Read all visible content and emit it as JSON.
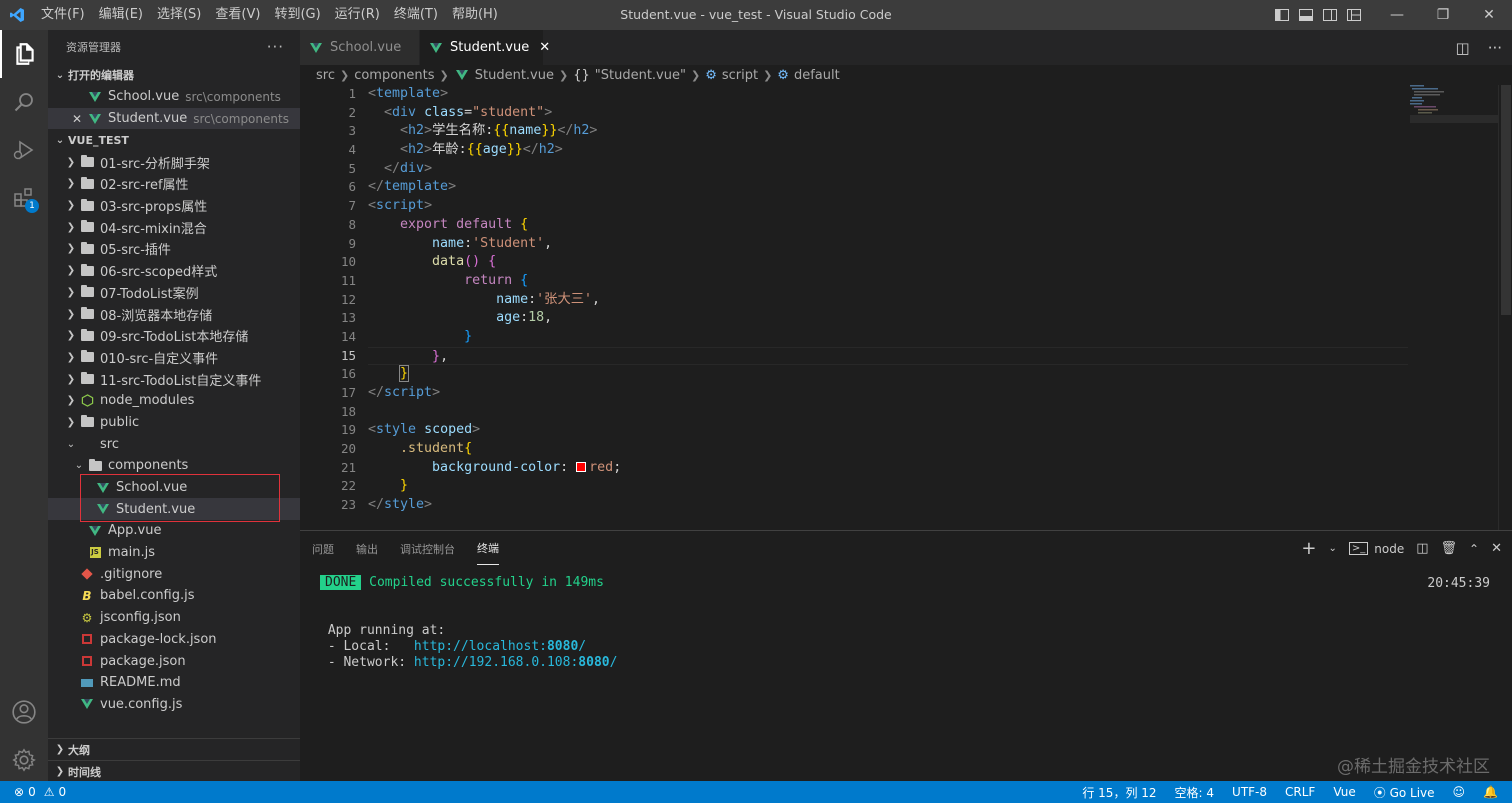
{
  "titlebar": {
    "menu": [
      "文件(F)",
      "编辑(E)",
      "选择(S)",
      "查看(V)",
      "转到(G)",
      "运行(R)",
      "终端(T)",
      "帮助(H)"
    ],
    "title": "Student.vue - vue_test - Visual Studio Code"
  },
  "activity": {
    "extensions_badge": "1"
  },
  "sidebar": {
    "title": "资源管理器",
    "open_editors_header": "打开的编辑器",
    "open_editors": [
      {
        "name": "School.vue",
        "path": "src\\components"
      },
      {
        "name": "Student.vue",
        "path": "src\\components"
      }
    ],
    "project_header": "VUE_TEST",
    "tree": [
      {
        "name": "01-src-分析脚手架"
      },
      {
        "name": "02-src-ref属性"
      },
      {
        "name": "03-src-props属性"
      },
      {
        "name": "04-src-mixin混合"
      },
      {
        "name": "05-src-插件"
      },
      {
        "name": "06-src-scoped样式"
      },
      {
        "name": "07-TodoList案例"
      },
      {
        "name": "08-浏览器本地存储"
      },
      {
        "name": "09-src-TodoList本地存储"
      },
      {
        "name": "010-src-自定义事件"
      },
      {
        "name": "11-src-TodoList自定义事件"
      },
      {
        "name": "node_modules"
      },
      {
        "name": "public"
      },
      {
        "name": "src"
      },
      {
        "name": "components"
      },
      {
        "name": "School.vue"
      },
      {
        "name": "Student.vue"
      },
      {
        "name": "App.vue"
      },
      {
        "name": "main.js"
      },
      {
        "name": ".gitignore"
      },
      {
        "name": "babel.config.js"
      },
      {
        "name": "jsconfig.json"
      },
      {
        "name": "package-lock.json"
      },
      {
        "name": "package.json"
      },
      {
        "name": "README.md"
      },
      {
        "name": "vue.config.js"
      }
    ],
    "outline_header": "大纲",
    "timeline_header": "时间线"
  },
  "tabs": [
    {
      "label": "School.vue"
    },
    {
      "label": "Student.vue"
    }
  ],
  "breadcrumbs": {
    "src": "src",
    "components": "components",
    "file": "Student.vue",
    "symbol": "\"Student.vue\"",
    "script": "script",
    "default": "default"
  },
  "editor": {
    "line_numbers": [
      "1",
      "2",
      "3",
      "4",
      "5",
      "6",
      "7",
      "8",
      "9",
      "10",
      "11",
      "12",
      "13",
      "14",
      "15",
      "16",
      "17",
      "18",
      "19",
      "20",
      "21",
      "22",
      "23"
    ],
    "current_line": "15",
    "student_name": "'张大三'",
    "name_value": "'Student'",
    "age_value": "18",
    "class_value": "\"student\"",
    "h2_label_1": "学生名称:",
    "h2_label_2": "年龄:",
    "color_value": "red"
  },
  "panel": {
    "tabs": [
      "问题",
      "输出",
      "调试控制台",
      "终端"
    ],
    "terminal_name": "node",
    "done_badge": "DONE",
    "compiled": "Compiled successfully in 149ms",
    "time": "20:45:39",
    "running_at": "App running at:",
    "local_label": "- Local:   ",
    "local_url_host": "http://localhost:",
    "port": "8080",
    "url_tail": "/",
    "network_label": "- Network: ",
    "network_url_host": "http://192.168.0.108:",
    "watermark": "@稀土掘金技术社区"
  },
  "statusbar": {
    "errors": "0",
    "warnings": "0",
    "position": "行 15，列 12",
    "spaces": "空格: 4",
    "encoding": "UTF-8",
    "eol": "CRLF",
    "language": "Vue",
    "golive": "Go Live"
  }
}
